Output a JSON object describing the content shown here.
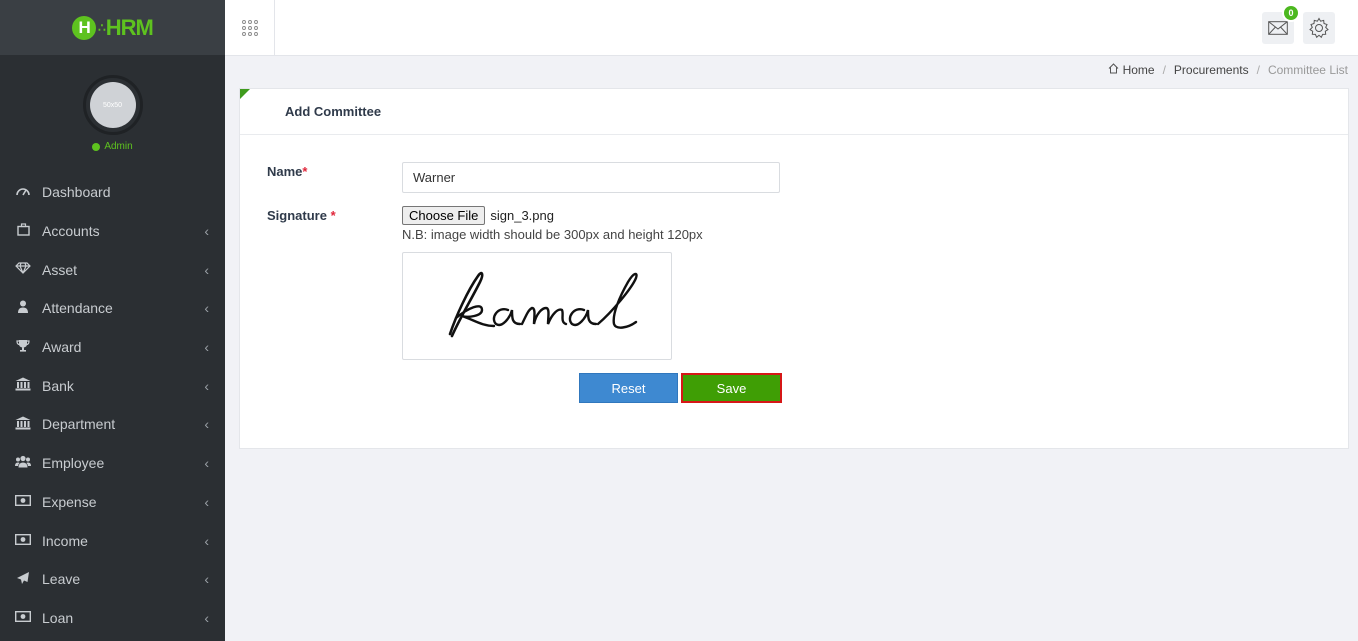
{
  "brand": {
    "logo_letter": "H",
    "logo_text": "HRM"
  },
  "user": {
    "avatar_text": "50x50",
    "role": "Admin"
  },
  "sidebar": {
    "items": [
      {
        "label": "Dashboard",
        "icon": "dashboard-icon",
        "has_submenu": false
      },
      {
        "label": "Accounts",
        "icon": "briefcase-icon",
        "has_submenu": true
      },
      {
        "label": "Asset",
        "icon": "diamond-icon",
        "has_submenu": true
      },
      {
        "label": "Attendance",
        "icon": "user-icon",
        "has_submenu": true
      },
      {
        "label": "Award",
        "icon": "trophy-icon",
        "has_submenu": true
      },
      {
        "label": "Bank",
        "icon": "bank-icon",
        "has_submenu": true
      },
      {
        "label": "Department",
        "icon": "bank-icon",
        "has_submenu": true
      },
      {
        "label": "Employee",
        "icon": "users-icon",
        "has_submenu": true
      },
      {
        "label": "Expense",
        "icon": "money-icon",
        "has_submenu": true
      },
      {
        "label": "Income",
        "icon": "money-icon",
        "has_submenu": true
      },
      {
        "label": "Leave",
        "icon": "plane-icon",
        "has_submenu": true
      },
      {
        "label": "Loan",
        "icon": "money-icon",
        "has_submenu": true
      }
    ]
  },
  "header": {
    "mail_count": "0"
  },
  "breadcrumb": {
    "home": "Home",
    "parent": "Procurements",
    "current": "Committee List"
  },
  "card": {
    "title": "Add Committee"
  },
  "form": {
    "name_label": "Name",
    "name_value": "Warner",
    "signature_label": "Signature ",
    "required_mark": "*",
    "choose_file_label": "Choose File",
    "file_name": "sign_3.png",
    "note": "N.B: image width should be 300px and height 120px",
    "signature_preview_text": "kamal",
    "reset_label": "Reset",
    "save_label": "Save"
  },
  "colors": {
    "accent_green": "#3f9e05",
    "reset_blue": "#3e89d1",
    "sidebar_bg": "#2b2f33",
    "highlight_red": "#d61717"
  }
}
